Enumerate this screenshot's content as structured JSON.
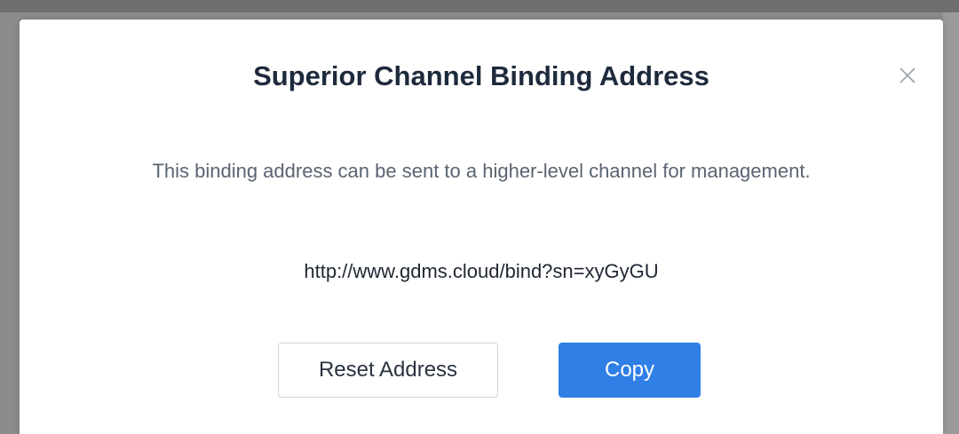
{
  "dialog": {
    "title": "Superior Channel Binding Address",
    "description": "This binding address can be sent to a higher-level channel for management.",
    "binding_url": "http://www.gdms.cloud/bind?sn=xyGyGU",
    "close_icon": "close-icon",
    "buttons": {
      "reset_label": "Reset Address",
      "copy_label": "Copy"
    }
  },
  "colors": {
    "primary": "#2f7fe6",
    "title_text": "#1e2a3c",
    "body_text": "#5b6472"
  }
}
